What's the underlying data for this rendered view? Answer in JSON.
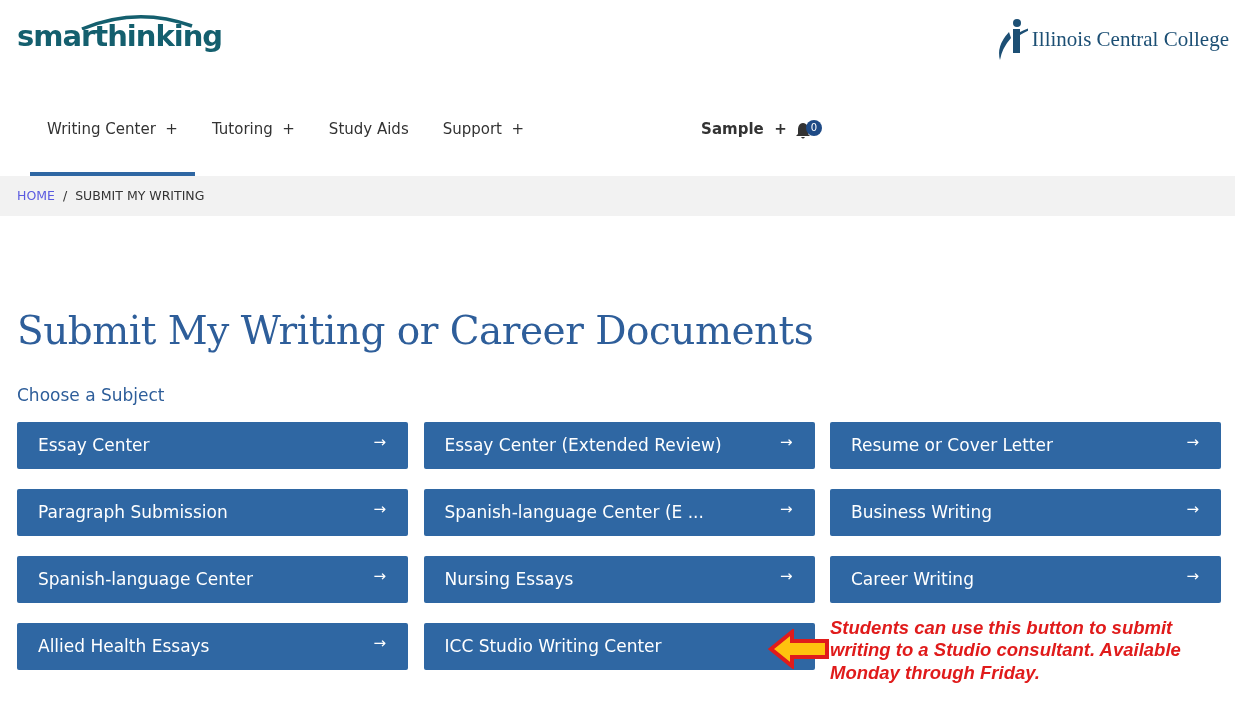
{
  "header": {
    "logo": "smarthinking",
    "college_logo": "Illinois Central College"
  },
  "nav": {
    "items": [
      {
        "label": "Writing Center",
        "expandable": true,
        "selected": true
      },
      {
        "label": "Tutoring",
        "expandable": true,
        "selected": false
      },
      {
        "label": "Study Aids",
        "expandable": false,
        "selected": false
      },
      {
        "label": "Support",
        "expandable": true,
        "selected": false
      }
    ],
    "plus_sign": "+",
    "user": {
      "label": "Sample",
      "expandable": true
    },
    "notifications": {
      "count": "0"
    }
  },
  "breadcrumb": [
    {
      "label": "HOME",
      "kind": "link"
    },
    {
      "label": "SUBMIT MY WRITING",
      "kind": "current"
    }
  ],
  "breadcrumb_separator": "/",
  "title": "Submit My Writing or Career Documents",
  "subtitle": "Choose a Subject",
  "subjects": [
    {
      "label": "Essay Center",
      "arrow": "→"
    },
    {
      "label": "Essay Center (Extended Review)",
      "arrow": "→"
    },
    {
      "label": "Resume or Cover Letter",
      "arrow": "→"
    },
    {
      "label": "Paragraph Submission",
      "arrow": "→"
    },
    {
      "label": "Spanish-language Center (E ...",
      "arrow": "→"
    },
    {
      "label": "Business Writing",
      "arrow": "→"
    },
    {
      "label": "Spanish-language Center",
      "arrow": "→"
    },
    {
      "label": "Nursing Essays",
      "arrow": "→"
    },
    {
      "label": "Career Writing",
      "arrow": "→"
    },
    {
      "label": "Allied Health Essays",
      "arrow": "→"
    },
    {
      "label": "ICC Studio Writing Center"
    }
  ],
  "annotation": {
    "text": "Students can use this button to submit writing to a Studio consultant. Available Monday through Friday."
  }
}
